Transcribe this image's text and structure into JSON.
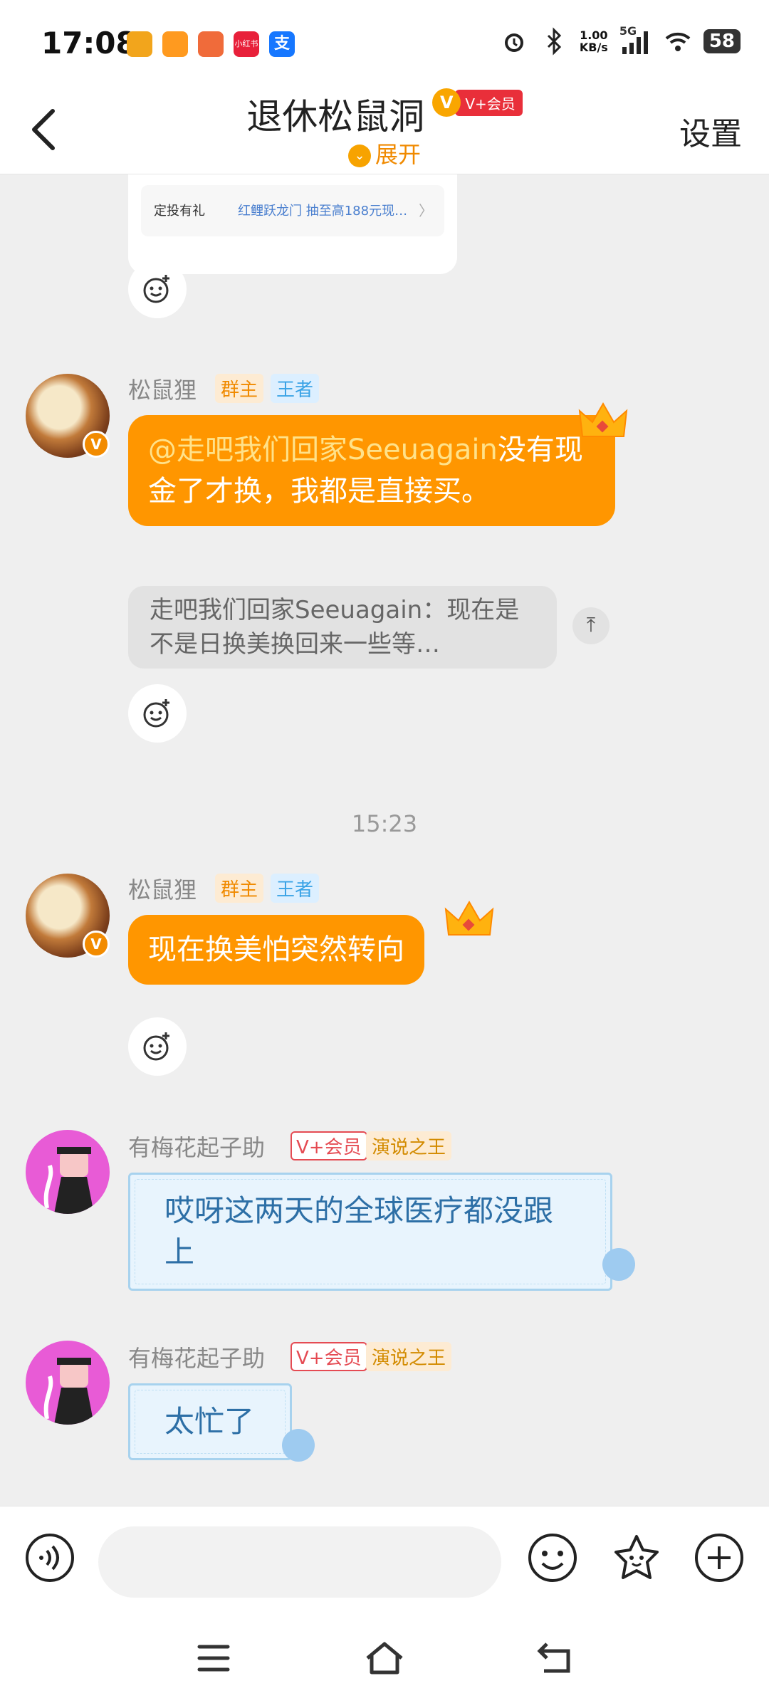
{
  "status_bar": {
    "time": "17:08",
    "net_speed_value": "1.00",
    "net_speed_unit": "KB/s",
    "network": "5G",
    "battery": "58",
    "app_icons": [
      "weibo-icon",
      "app-icon",
      "avatar-app-icon",
      "xiaohongshu-icon",
      "alipay-icon"
    ],
    "app_icon_colors": [
      "#f2a51c",
      "#ff9a1f",
      "#f06b3a",
      "#e8203a",
      "#1677ff"
    ],
    "xhs_label": "小红书",
    "alipay_label": "支"
  },
  "header": {
    "title": "退休松鼠洞",
    "vip_mark": "V",
    "vip_label": "V+会员",
    "expand_label": "展开",
    "settings_label": "设置"
  },
  "card": {
    "left_text": "定投有礼",
    "right_text": "红鲤跃龙门 抽至高188元现…",
    "arrow": "〉"
  },
  "messages": [
    {
      "sender": "松鼠狸",
      "tags": [
        "群主",
        "王者"
      ],
      "mention": "@走吧我们回家Seeuagain",
      "text": "没有现金了才换，我都是直接买。",
      "quote": "走吧我们回家Seeuagain：现在是不是日换美换回来一些等…",
      "quote_btn": "⤒"
    },
    {
      "sender": "松鼠狸",
      "tags": [
        "群主",
        "王者"
      ],
      "text": "现在换美怕突然转向"
    },
    {
      "sender": "有梅花起子助",
      "tags": [
        "V+会员",
        "演说之王"
      ],
      "text": "哎呀这两天的全球医疗都没跟上"
    },
    {
      "sender": "有梅花起子助",
      "tags": [
        "V+会员",
        "演说之王"
      ],
      "text": "太忙了"
    }
  ],
  "time_divider": "15:23",
  "avatar_badge": "V",
  "colors": {
    "accent_orange": "#ff9600",
    "bubble_blue_text": "#2d6fa6",
    "owner_tag": "#f08a00",
    "king_tag": "#3aa3e6",
    "vip_red": "#e54b53"
  },
  "input_bar": {
    "placeholder": ""
  }
}
